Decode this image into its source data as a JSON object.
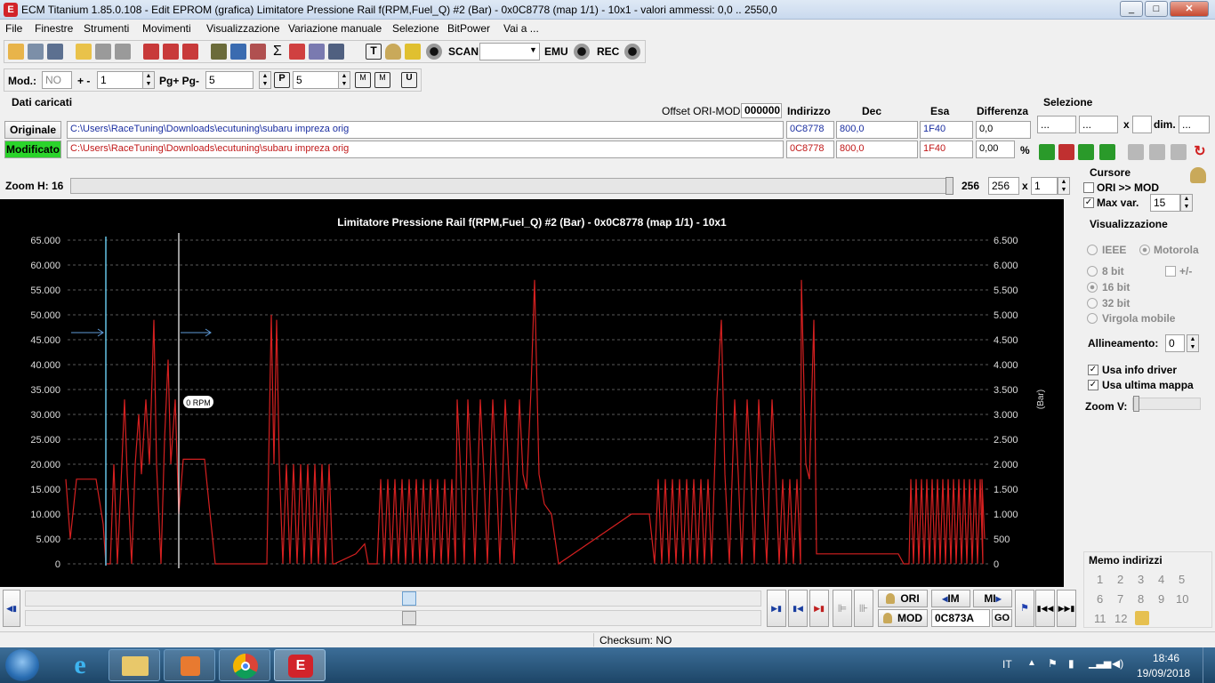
{
  "window": {
    "title": "ECM Titanium 1.85.0.108 - Edit EPROM (grafica) Limitatore Pressione Rail f(RPM,Fuel_Q) #2 (Bar) - 0x0C8778 (map 1/1) - 10x1 - valori ammessi: 0,0 .. 2550,0",
    "app_icon": "ecm-titanium-icon",
    "btn_min": "_",
    "btn_max": "□",
    "btn_close": "✕"
  },
  "menu": [
    "File",
    "Finestre",
    "Strumenti",
    "Movimenti",
    "Visualizzazione",
    "Variazione manuale",
    "Selezione",
    "BitPower",
    "Vai a ..."
  ],
  "toolbar": {
    "scan": "SCAN",
    "emu": "EMU",
    "rec": "REC"
  },
  "toolbar2": {
    "mod_label": "Mod.:",
    "mod_value": "NO",
    "plusminus": "+ -",
    "step_value": "1",
    "pg_label": "Pg+ Pg-",
    "pg_value": "5",
    "p_value": "5"
  },
  "dati": {
    "section": "Dati caricati",
    "offset_label": "Offset ORI-MOD",
    "offset_value": "000000",
    "col_indirizzo": "Indirizzo",
    "col_dec": "Dec",
    "col_esa": "Esa",
    "col_diff": "Differenza",
    "orig_label": "Originale",
    "orig_path": "C:\\Users\\RaceTuning\\Downloads\\ecutuning\\subaru impreza orig",
    "orig_addr": "0C8778",
    "orig_dec": "800,0",
    "orig_esa": "1F40",
    "orig_diff": "0,0",
    "mod_label": "Modificato",
    "mod_path": "C:\\Users\\RaceTuning\\Downloads\\ecutuning\\subaru impreza orig",
    "mod_addr": "0C8778",
    "mod_dec": "800,0",
    "mod_esa": "1F40",
    "mod_diff": "0,00",
    "percent": "%"
  },
  "selezione": {
    "title": "Selezione",
    "f1": "...",
    "f2": "...",
    "x": "x",
    "dim_label": "dim.",
    "dim": "..."
  },
  "zoom": {
    "label": "Zoom H: 16",
    "val1": "256",
    "val2": "256",
    "x": "x",
    "mult": "1"
  },
  "cursore": {
    "title": "Cursore",
    "ori_mod": "ORI >> MOD",
    "max_var": "Max var.",
    "max_var_value": "15"
  },
  "visual": {
    "title": "Visualizzazione",
    "ieee": "IEEE",
    "motorola": "Motorola",
    "bit8": "8 bit",
    "plusminus": "+/-",
    "bit16": "16 bit",
    "bit32": "32 bit",
    "virgola": "Virgola mobile",
    "allineamento": "Allineamento:",
    "allin_value": "0",
    "usa_info": "Usa info driver",
    "usa_ultima": "Usa ultima mappa",
    "zoom_v": "Zoom V:"
  },
  "memo": {
    "title": "Memo indirizzi",
    "nums": [
      "1",
      "2",
      "3",
      "4",
      "5",
      "6",
      "7",
      "8",
      "9",
      "10",
      "11",
      "12"
    ]
  },
  "nav": {
    "ori": "ORI",
    "mod": "MOD",
    "im": "IM",
    "mi": "MI",
    "addr": "0C873A",
    "go": "GO"
  },
  "status": {
    "checksum": "Checksum: NO"
  },
  "taskbar": {
    "lang": "IT",
    "time": "18:46",
    "date": "19/09/2018"
  },
  "chart_data": {
    "type": "line",
    "title": "Limitatore Pressione Rail f(RPM,Fuel_Q) #2 (Bar) - 0x0C8778 (map 1/1) - 10x1",
    "y_left_ticks": [
      "65.000",
      "60.000",
      "55.000",
      "50.000",
      "45.000",
      "40.000",
      "35.000",
      "30.000",
      "25.000",
      "20.000",
      "15.000",
      "10.000",
      "5.000",
      "0"
    ],
    "y_right_ticks": [
      "6.500",
      "6.000",
      "5.500",
      "5.000",
      "4.500",
      "4.000",
      "3.500",
      "3.000",
      "2.500",
      "2.000",
      "1.500",
      "1.000",
      "500",
      "0"
    ],
    "ylabel_right": "(Bar)",
    "ylim": [
      0,
      65000
    ],
    "cursor_label": "0 RPM",
    "series_color": "#d42020"
  }
}
